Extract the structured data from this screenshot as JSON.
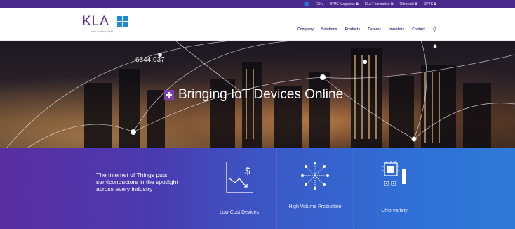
{
  "utility": {
    "globe_icon": "globe-icon",
    "links": [
      "EN ∨",
      "IPMS Magazine ⧉",
      "KLA Foundation ⧉",
      "Orbotech ⧉",
      "SPTS ⧉"
    ]
  },
  "header": {
    "logo_text": "KLA",
    "logo_tagline": "Keep Looking Ahead",
    "nav": [
      "Company",
      "Solutions",
      "Products",
      "Careers",
      "Investors",
      "Contact"
    ],
    "search_icon": "search-icon"
  },
  "hero": {
    "counter": "6344.037",
    "title": "Bringing IoT Devices Online"
  },
  "band": {
    "copy": "The Internet of Things puts semiconductors in the spotlight across every industry",
    "features": [
      {
        "label": "Low Cost Devices",
        "icon": "cost-down-chart-icon"
      },
      {
        "label": "High Volume Production",
        "icon": "network-burst-icon"
      },
      {
        "label": "Chip Variety",
        "icon": "chip-icon"
      }
    ]
  },
  "colors": {
    "utility_bar": "#4a2a8c",
    "brand_purple": "#5a2d91",
    "brand_blue": "#1e88d8",
    "band_start": "#5a2da0",
    "band_end": "#2f7ad8"
  }
}
